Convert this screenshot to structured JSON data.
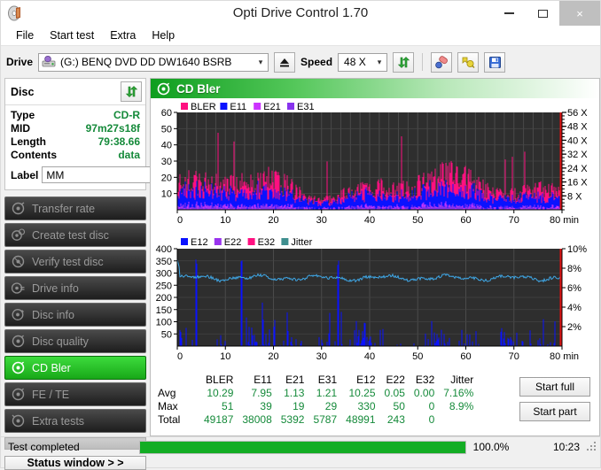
{
  "window": {
    "title": "Opti Drive Control 1.70",
    "icon": "disc-icon",
    "minimize": "minimize-icon",
    "maximize": "maximize-icon",
    "close": "×"
  },
  "menu": {
    "items": [
      "File",
      "Start test",
      "Extra",
      "Help"
    ]
  },
  "toolbar": {
    "drive_label": "Drive",
    "drive_value": "(G:)   BENQ DVD DD DW1640 BSRB",
    "drive_icon": "drive-icon",
    "eject_icon": "eject-icon",
    "speed_label": "Speed",
    "speed_value": "48 X",
    "refresh_icon": "refresh-icon",
    "erase_icon": "erase-icon",
    "bookmark_icon": "bookmark-icon",
    "save_icon": "save-icon"
  },
  "disc": {
    "title": "Disc",
    "refresh_icon": "refresh-icon",
    "rows": [
      {
        "key": "Type",
        "value": "CD-R"
      },
      {
        "key": "MID",
        "value": "97m27s18f"
      },
      {
        "key": "Length",
        "value": "79:38.66"
      },
      {
        "key": "Contents",
        "value": "data"
      }
    ],
    "label_key": "Label",
    "label_value": "MM",
    "label_placeholder": "",
    "disc_icon": "cd-icon"
  },
  "nav": {
    "items": [
      {
        "label": "Transfer rate",
        "icon": "disc-test-icon",
        "active": false
      },
      {
        "label": "Create test disc",
        "icon": "disc-burn-icon",
        "active": false
      },
      {
        "label": "Verify test disc",
        "icon": "disc-verify-icon",
        "active": false
      },
      {
        "label": "Drive info",
        "icon": "drive-info-icon",
        "active": false
      },
      {
        "label": "Disc info",
        "icon": "disc-info-icon",
        "active": false
      },
      {
        "label": "Disc quality",
        "icon": "disc-quality-icon",
        "active": false
      },
      {
        "label": "CD Bler",
        "icon": "cd-bler-icon",
        "active": true
      },
      {
        "label": "FE / TE",
        "icon": "fe-te-icon",
        "active": false
      },
      {
        "label": "Extra tests",
        "icon": "extra-tests-icon",
        "active": false
      }
    ],
    "status_window": "Status window > >"
  },
  "content": {
    "title": "CD Bler",
    "title_icon": "cd-bler-icon"
  },
  "chart_data": [
    {
      "type": "line",
      "id": "cd-bler-error-chart",
      "title": "CD Bler",
      "xlabel": "min",
      "ylabel": "",
      "xlim": [
        0,
        80
      ],
      "ylim": [
        0,
        60
      ],
      "xticks": [
        0,
        10,
        20,
        30,
        40,
        50,
        60,
        70,
        80
      ],
      "xtick_labels": [
        "0",
        "10",
        "20",
        "30",
        "40",
        "50",
        "60",
        "70",
        "80 min"
      ],
      "yticks": [
        10,
        20,
        30,
        40,
        50,
        60
      ],
      "ytick_labels": [
        "10",
        "20",
        "30",
        "40",
        "50",
        "60"
      ],
      "y2lim": [
        0,
        56
      ],
      "y2ticks": [
        8,
        16,
        24,
        32,
        40,
        48,
        56
      ],
      "y2tick_labels": [
        "8 X",
        "16 X",
        "24 X",
        "32 X",
        "40 X",
        "48 X",
        "56 X"
      ],
      "grid": true,
      "legend_position": "top-left",
      "plot_bg": "#2e2e2e",
      "series": [
        {
          "name": "BLER",
          "color": "#ff1080",
          "avg": 10.29,
          "max": 51,
          "total": 49187
        },
        {
          "name": "E11",
          "color": "#0a12ff",
          "avg": 7.95,
          "max": 39,
          "total": 38008
        },
        {
          "name": "E21",
          "color": "#cc33ff",
          "avg": 1.13,
          "max": 19,
          "total": 5392
        },
        {
          "name": "E31",
          "color": "#8833ee",
          "avg": 1.21,
          "max": 29,
          "total": 5787
        }
      ]
    },
    {
      "type": "line",
      "id": "cd-bler-e12-chart",
      "title": "",
      "xlabel": "min",
      "ylabel": "",
      "xlim": [
        0,
        80
      ],
      "ylim": [
        0,
        400
      ],
      "xticks": [
        0,
        10,
        20,
        30,
        40,
        50,
        60,
        70,
        80
      ],
      "xtick_labels": [
        "0",
        "10",
        "20",
        "30",
        "40",
        "50",
        "60",
        "70",
        "80 min"
      ],
      "yticks": [
        50,
        100,
        150,
        200,
        250,
        300,
        350,
        400
      ],
      "ytick_labels": [
        "50",
        "100",
        "150",
        "200",
        "250",
        "300",
        "350",
        "400"
      ],
      "y2lim": [
        0,
        10
      ],
      "y2ticks": [
        2,
        4,
        6,
        8,
        10
      ],
      "y2tick_labels": [
        "2%",
        "4%",
        "6%",
        "8%",
        "10%"
      ],
      "grid": true,
      "legend_position": "top-left",
      "plot_bg": "#2e2e2e",
      "series": [
        {
          "name": "E12",
          "color": "#0a12ff",
          "avg": 10.25,
          "max": 330,
          "total": 48991
        },
        {
          "name": "E22",
          "color": "#9933ee",
          "avg": 0.05,
          "max": 50,
          "total": 243
        },
        {
          "name": "E32",
          "color": "#ff1080",
          "avg": 0.0,
          "max": 0,
          "total": 0
        },
        {
          "name": "Jitter",
          "color": "#3f8f8f",
          "avg": "7.16%",
          "max": "8.9%",
          "total": ""
        }
      ]
    }
  ],
  "stats": {
    "columns": [
      "BLER",
      "E11",
      "E21",
      "E31",
      "E12",
      "E22",
      "E32",
      "Jitter"
    ],
    "rows": [
      {
        "label": "Avg",
        "values": [
          "10.29",
          "7.95",
          "1.13",
          "1.21",
          "10.25",
          "0.05",
          "0.00",
          "7.16%"
        ]
      },
      {
        "label": "Max",
        "values": [
          "51",
          "39",
          "19",
          "29",
          "330",
          "50",
          "0",
          "8.9%"
        ]
      },
      {
        "label": "Total",
        "values": [
          "49187",
          "38008",
          "5392",
          "5787",
          "48991",
          "243",
          "0",
          ""
        ]
      }
    ]
  },
  "actions": {
    "start_full": "Start full",
    "start_part": "Start part"
  },
  "statusbar": {
    "message": "Test completed",
    "progress_percent": "100.0%",
    "progress_value": 100,
    "time": "10:23"
  },
  "colors": {
    "accent_green": "#13ad24",
    "value_green": "#158a3a",
    "plot_bg": "#2e2e2e",
    "bler": "#ff1080",
    "e11": "#0a12ff",
    "e21": "#cc33ff",
    "e31": "#8833ee",
    "jitter": "#3f8f8f"
  }
}
